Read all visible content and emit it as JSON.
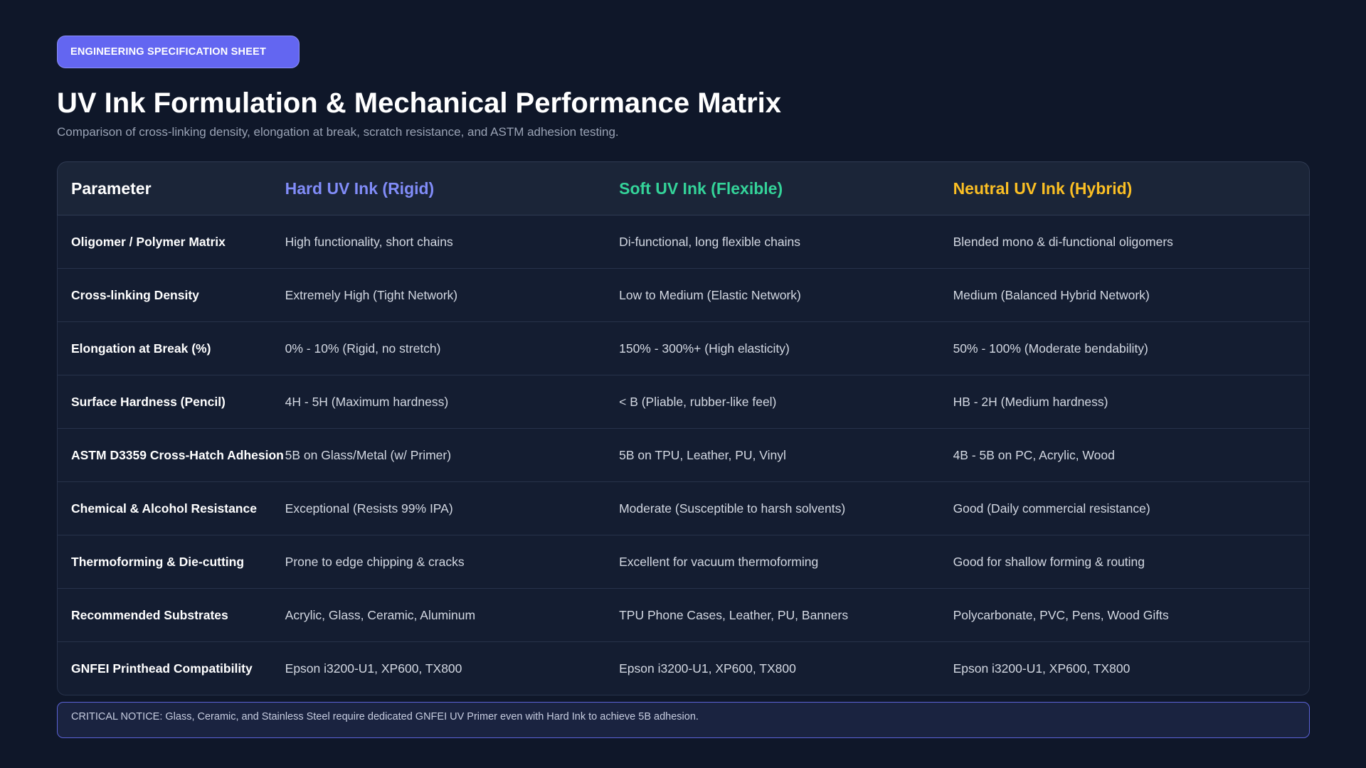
{
  "badge": "ENGINEERING SPECIFICATION SHEET",
  "title": "UV Ink Formulation & Mechanical Performance Matrix",
  "subtitle": "Comparison of cross-linking density, elongation at break, scratch resistance, and ASTM adhesion testing.",
  "colors": {
    "hard": "#818cf8",
    "soft": "#34d399",
    "neutral": "#fbbf24",
    "badge": "#6366f1"
  },
  "table": {
    "headers": [
      "Parameter",
      "Hard UV Ink (Rigid)",
      "Soft UV Ink (Flexible)",
      "Neutral UV Ink (Hybrid)"
    ],
    "rows": [
      [
        "Oligomer / Polymer Matrix",
        "High functionality, short chains",
        "Di-functional, long flexible chains",
        "Blended mono & di-functional oligomers"
      ],
      [
        "Cross-linking Density",
        "Extremely High (Tight Network)",
        "Low to Medium (Elastic Network)",
        "Medium (Balanced Hybrid Network)"
      ],
      [
        "Elongation at Break (%)",
        "0% - 10% (Rigid, no stretch)",
        "150% - 300%+ (High elasticity)",
        "50% - 100% (Moderate bendability)"
      ],
      [
        "Surface Hardness (Pencil)",
        "4H - 5H (Maximum hardness)",
        "< B (Pliable, rubber-like feel)",
        "HB - 2H (Medium hardness)"
      ],
      [
        "ASTM D3359 Cross-Hatch Adhesion",
        "5B on Glass/Metal (w/ Primer)",
        "5B on TPU, Leather, PU, Vinyl",
        "4B - 5B on PC, Acrylic, Wood"
      ],
      [
        "Chemical & Alcohol Resistance",
        "Exceptional (Resists 99% IPA)",
        "Moderate (Susceptible to harsh solvents)",
        "Good (Daily commercial resistance)"
      ],
      [
        "Thermoforming & Die-cutting",
        "Prone to edge chipping & cracks",
        "Excellent for vacuum thermoforming",
        "Good for shallow forming & routing"
      ],
      [
        "Recommended Substrates",
        "Acrylic, Glass, Ceramic, Aluminum",
        "TPU Phone Cases, Leather, PU, Banners",
        "Polycarbonate, PVC, Pens, Wood Gifts"
      ],
      [
        "GNFEI Printhead Compatibility",
        "Epson i3200-U1, XP600, TX800",
        "Epson i3200-U1, XP600, TX800",
        "Epson i3200-U1, XP600, TX800"
      ]
    ]
  },
  "notice": "CRITICAL NOTICE: Glass, Ceramic, and Stainless Steel require dedicated GNFEI UV Primer even with Hard Ink to achieve 5B adhesion."
}
